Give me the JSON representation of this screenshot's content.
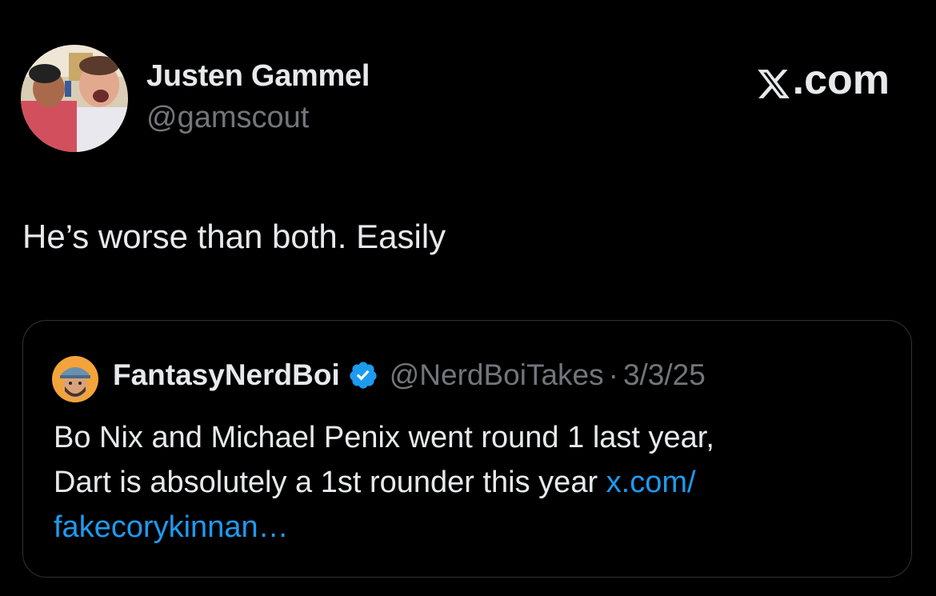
{
  "tweet": {
    "author_name": "Justen Gammel",
    "author_handle": "@gamscout",
    "text": "He’s worse than both. Easily"
  },
  "brand": {
    "label": ".com",
    "icon": "x-logo-icon"
  },
  "quote": {
    "author_name": "FantasyNerdBoi",
    "author_handle": "@NerdBoiTakes",
    "separator": "·",
    "date": "3/3/25",
    "text_line1": "Bo Nix and Michael Penix went round 1 last year,",
    "text_line2": "Dart is absolutely a 1st rounder this year ",
    "link_part1": "x.com/",
    "link_part2": "fakecorykinnan…",
    "verified_icon": "verified-badge-icon"
  },
  "colors": {
    "background": "#000000",
    "primary_text": "#e7e9ea",
    "secondary_text": "#71767b",
    "link": "#1d9bf0",
    "border": "#2f3336"
  }
}
